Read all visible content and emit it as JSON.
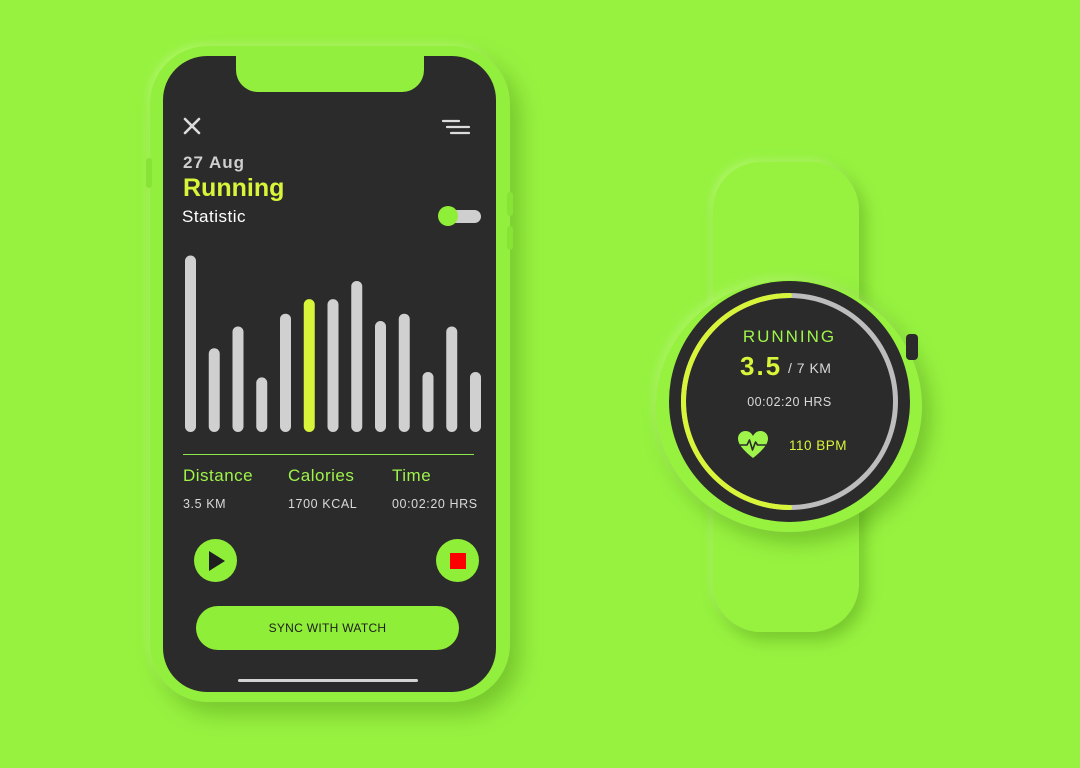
{
  "phone": {
    "date": "27 Aug",
    "title": "Running",
    "subtitle": "Statistic",
    "stats": {
      "distance_label": "Distance",
      "distance_value": "3.5 KM",
      "calories_label": "Calories",
      "calories_value": "1700 KCAL",
      "time_label": "Time",
      "time_value": "00:02:20 HRS"
    },
    "sync_label": "SYNC WITH WATCH",
    "toggle_on": true,
    "icons": {
      "close": "close-icon",
      "menu": "menu-icon",
      "play": "play-icon",
      "stop": "stop-icon"
    }
  },
  "watch": {
    "title": "RUNNING",
    "distance": "3.5",
    "goal": "/ 7 KM",
    "time": "00:02:20 HRS",
    "bpm": "110 BPM",
    "progress": 0.5,
    "icons": {
      "heart": "heart-rate-icon"
    }
  },
  "chart_data": {
    "type": "bar",
    "values": [
      0.97,
      0.46,
      0.58,
      0.3,
      0.65,
      0.73,
      0.73,
      0.83,
      0.61,
      0.65,
      0.33,
      0.58,
      0.33
    ],
    "highlight_index": 5,
    "ylim": [
      0,
      1
    ]
  },
  "colors": {
    "background": "#97f240",
    "screen": "#2b2b2b",
    "accent_green": "#8fee37",
    "accent_yellow": "#d8f53a",
    "bar_default": "#d0d0d0",
    "bar_highlight": "#d8f53a",
    "stop_red": "#ff0000"
  }
}
